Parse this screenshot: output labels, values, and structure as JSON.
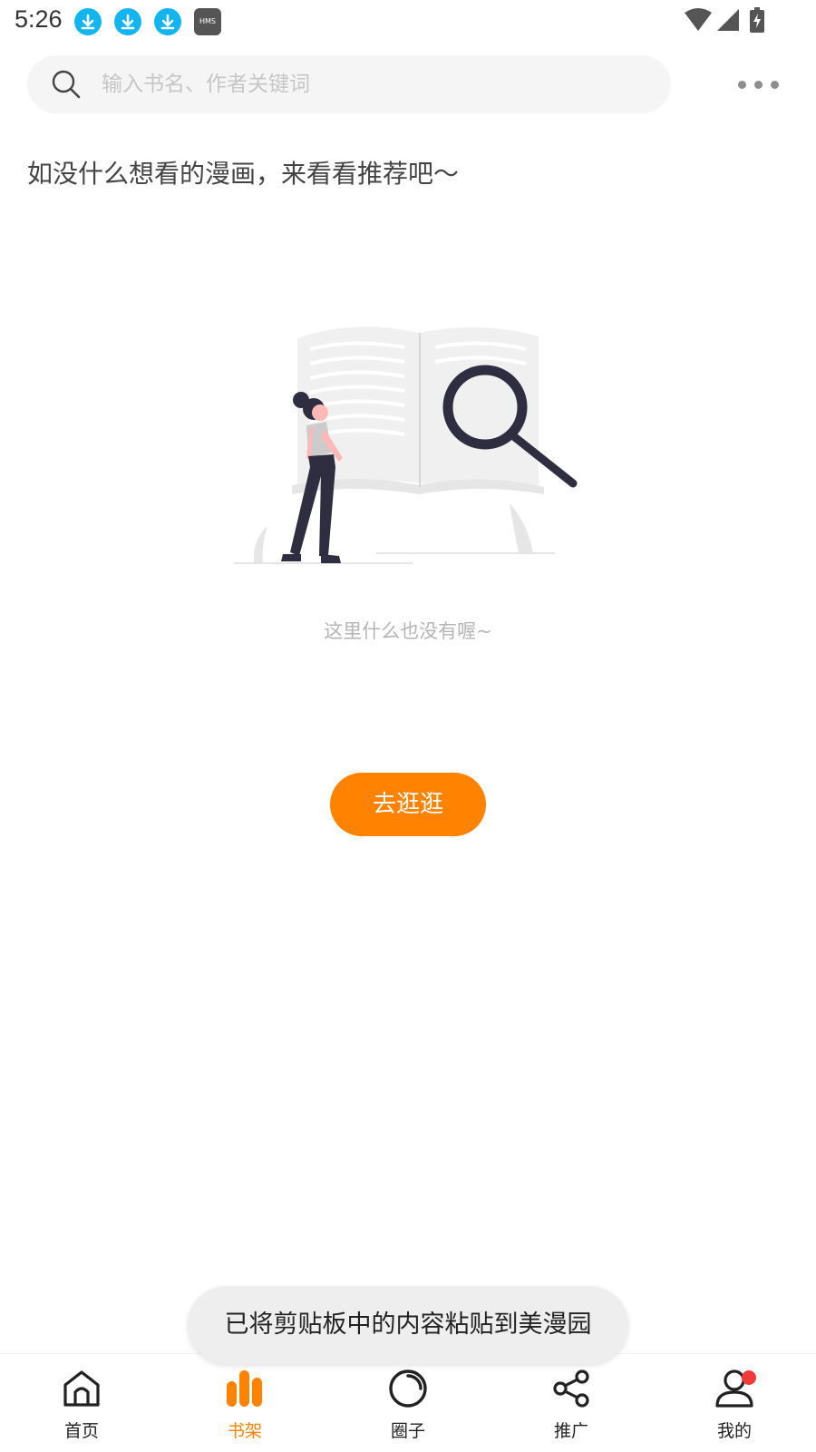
{
  "status_bar": {
    "time": "5:26",
    "hms_label": "HMS",
    "icons": [
      "download-notification-icon",
      "download-notification-icon",
      "download-notification-icon",
      "hms-icon",
      "wifi-icon",
      "cellular-signal-icon",
      "battery-charging-icon"
    ]
  },
  "search": {
    "placeholder": "输入书名、作者关键词"
  },
  "recommend_text": "如没什么想看的漫画，来看看推荐吧～",
  "empty_state": {
    "message": "这里什么也没有喔~",
    "button_label": "去逛逛"
  },
  "toast": {
    "message": "已将剪贴板中的内容粘贴到美漫园"
  },
  "bottom_nav": {
    "items": [
      {
        "label": "首页",
        "icon": "home-icon"
      },
      {
        "label": "书架",
        "icon": "bookshelf-icon",
        "active": true
      },
      {
        "label": "圈子",
        "icon": "circle-icon"
      },
      {
        "label": "推广",
        "icon": "share-icon"
      },
      {
        "label": "我的",
        "icon": "profile-icon"
      }
    ]
  },
  "colors": {
    "accent": "#ff8200",
    "notification_blue": "#12b5ef",
    "badge_red": "#f23a3a",
    "illustration_dark": "#2f2e41"
  }
}
